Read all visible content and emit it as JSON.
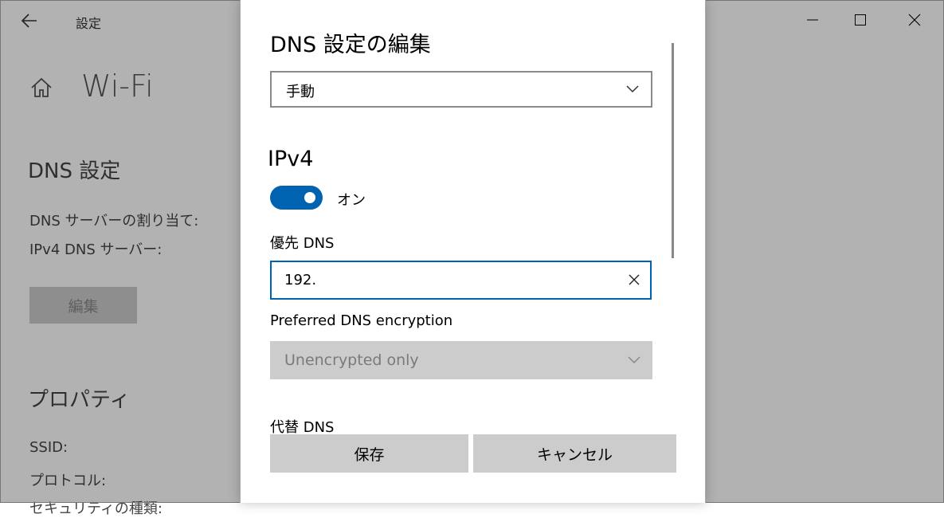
{
  "window": {
    "app_title": "設定",
    "icons": {
      "back": "back-arrow-icon",
      "minimize": "minimize-icon",
      "maximize": "maximize-icon",
      "close": "close-icon",
      "home": "home-icon"
    }
  },
  "background": {
    "page_title": "Wi-Fi",
    "dns_section_heading": "DNS 設定",
    "dns_assignment_label": "DNS サーバーの割り当て:",
    "ipv4_dns_label": "IPv4 DNS サーバー:",
    "edit_button": "編集",
    "properties_heading": "プロパティ",
    "ssid_label": "SSID:",
    "protocol_label": "プロトコル:",
    "cut_row": "セキュリティの種類:"
  },
  "dialog": {
    "title": "DNS 設定の編集",
    "mode_select": {
      "value": "手動"
    },
    "ipv4": {
      "heading": "IPv4",
      "toggle_on": true,
      "toggle_state_label": "オン",
      "preferred_dns_label": "優先 DNS",
      "preferred_dns_value": "192.",
      "preferred_encryption_label": "Preferred DNS encryption",
      "preferred_encryption_value": "Unencrypted only",
      "alternate_dns_label": "代替 DNS"
    },
    "buttons": {
      "save": "保存",
      "cancel": "キャンセル"
    }
  },
  "colors": {
    "accent": "#0063b1",
    "button_gray": "#cccccc",
    "disabled_text": "#7a7a7a"
  }
}
